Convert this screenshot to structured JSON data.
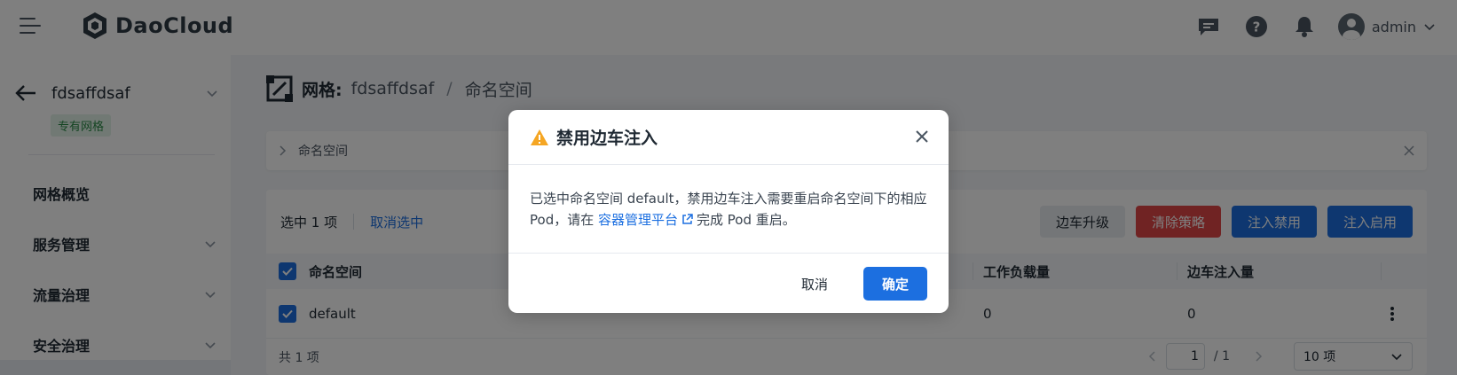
{
  "header": {
    "brand": "DaoCloud",
    "user": "admin"
  },
  "sidebar": {
    "mesh_name": "fdsaffdsaf",
    "mesh_tag": "专有网格",
    "items": [
      {
        "label": "网格概览"
      },
      {
        "label": "服务管理"
      },
      {
        "label": "流量治理"
      },
      {
        "label": "安全治理"
      }
    ]
  },
  "main": {
    "breadcrumb": {
      "label": "网格:",
      "mesh": "fdsaffdsaf",
      "separator": "/",
      "page": "命名空间"
    },
    "info_bar": {
      "label": "命名空间"
    },
    "toolbar": {
      "selected": "选中 1 项",
      "deselect": "取消选中",
      "sidecar_upgrade": "边车升级",
      "clear_policy": "清除策略",
      "injection_disable": "注入禁用",
      "injection_enable": "注入启用"
    },
    "table": {
      "columns": {
        "namespace": "命名空间",
        "workloads": "工作负载量",
        "sidecars": "边车注入量"
      },
      "rows": [
        {
          "namespace": "default",
          "workloads": "0",
          "sidecars": "0"
        }
      ]
    },
    "footer": {
      "total": "共 1 项",
      "page": "1",
      "page_total": "/ 1",
      "page_size": "10 项"
    }
  },
  "modal": {
    "title": "禁用边车注入",
    "body_pre": "已选中命名空间 default，禁用边车注入需要重启命名空间下的相应 Pod，请在 ",
    "body_link": "容器管理平台",
    "body_post": "完成 Pod 重启。",
    "cancel": "取消",
    "confirm": "确定"
  },
  "colors": {
    "primary": "#1c6fe0",
    "danger": "#e04646",
    "warning": "#f5a623",
    "tag_green": "#2b8a47"
  },
  "icons": [
    "menu-icon",
    "daocloud-logo-icon",
    "message-icon",
    "help-icon",
    "bell-icon",
    "user-avatar-icon",
    "chevron-down-icon",
    "back-arrow-icon",
    "mesh-icon",
    "chevron-right-icon",
    "close-icon",
    "check-icon",
    "more-vertical-icon",
    "warning-icon",
    "external-link-icon"
  ]
}
